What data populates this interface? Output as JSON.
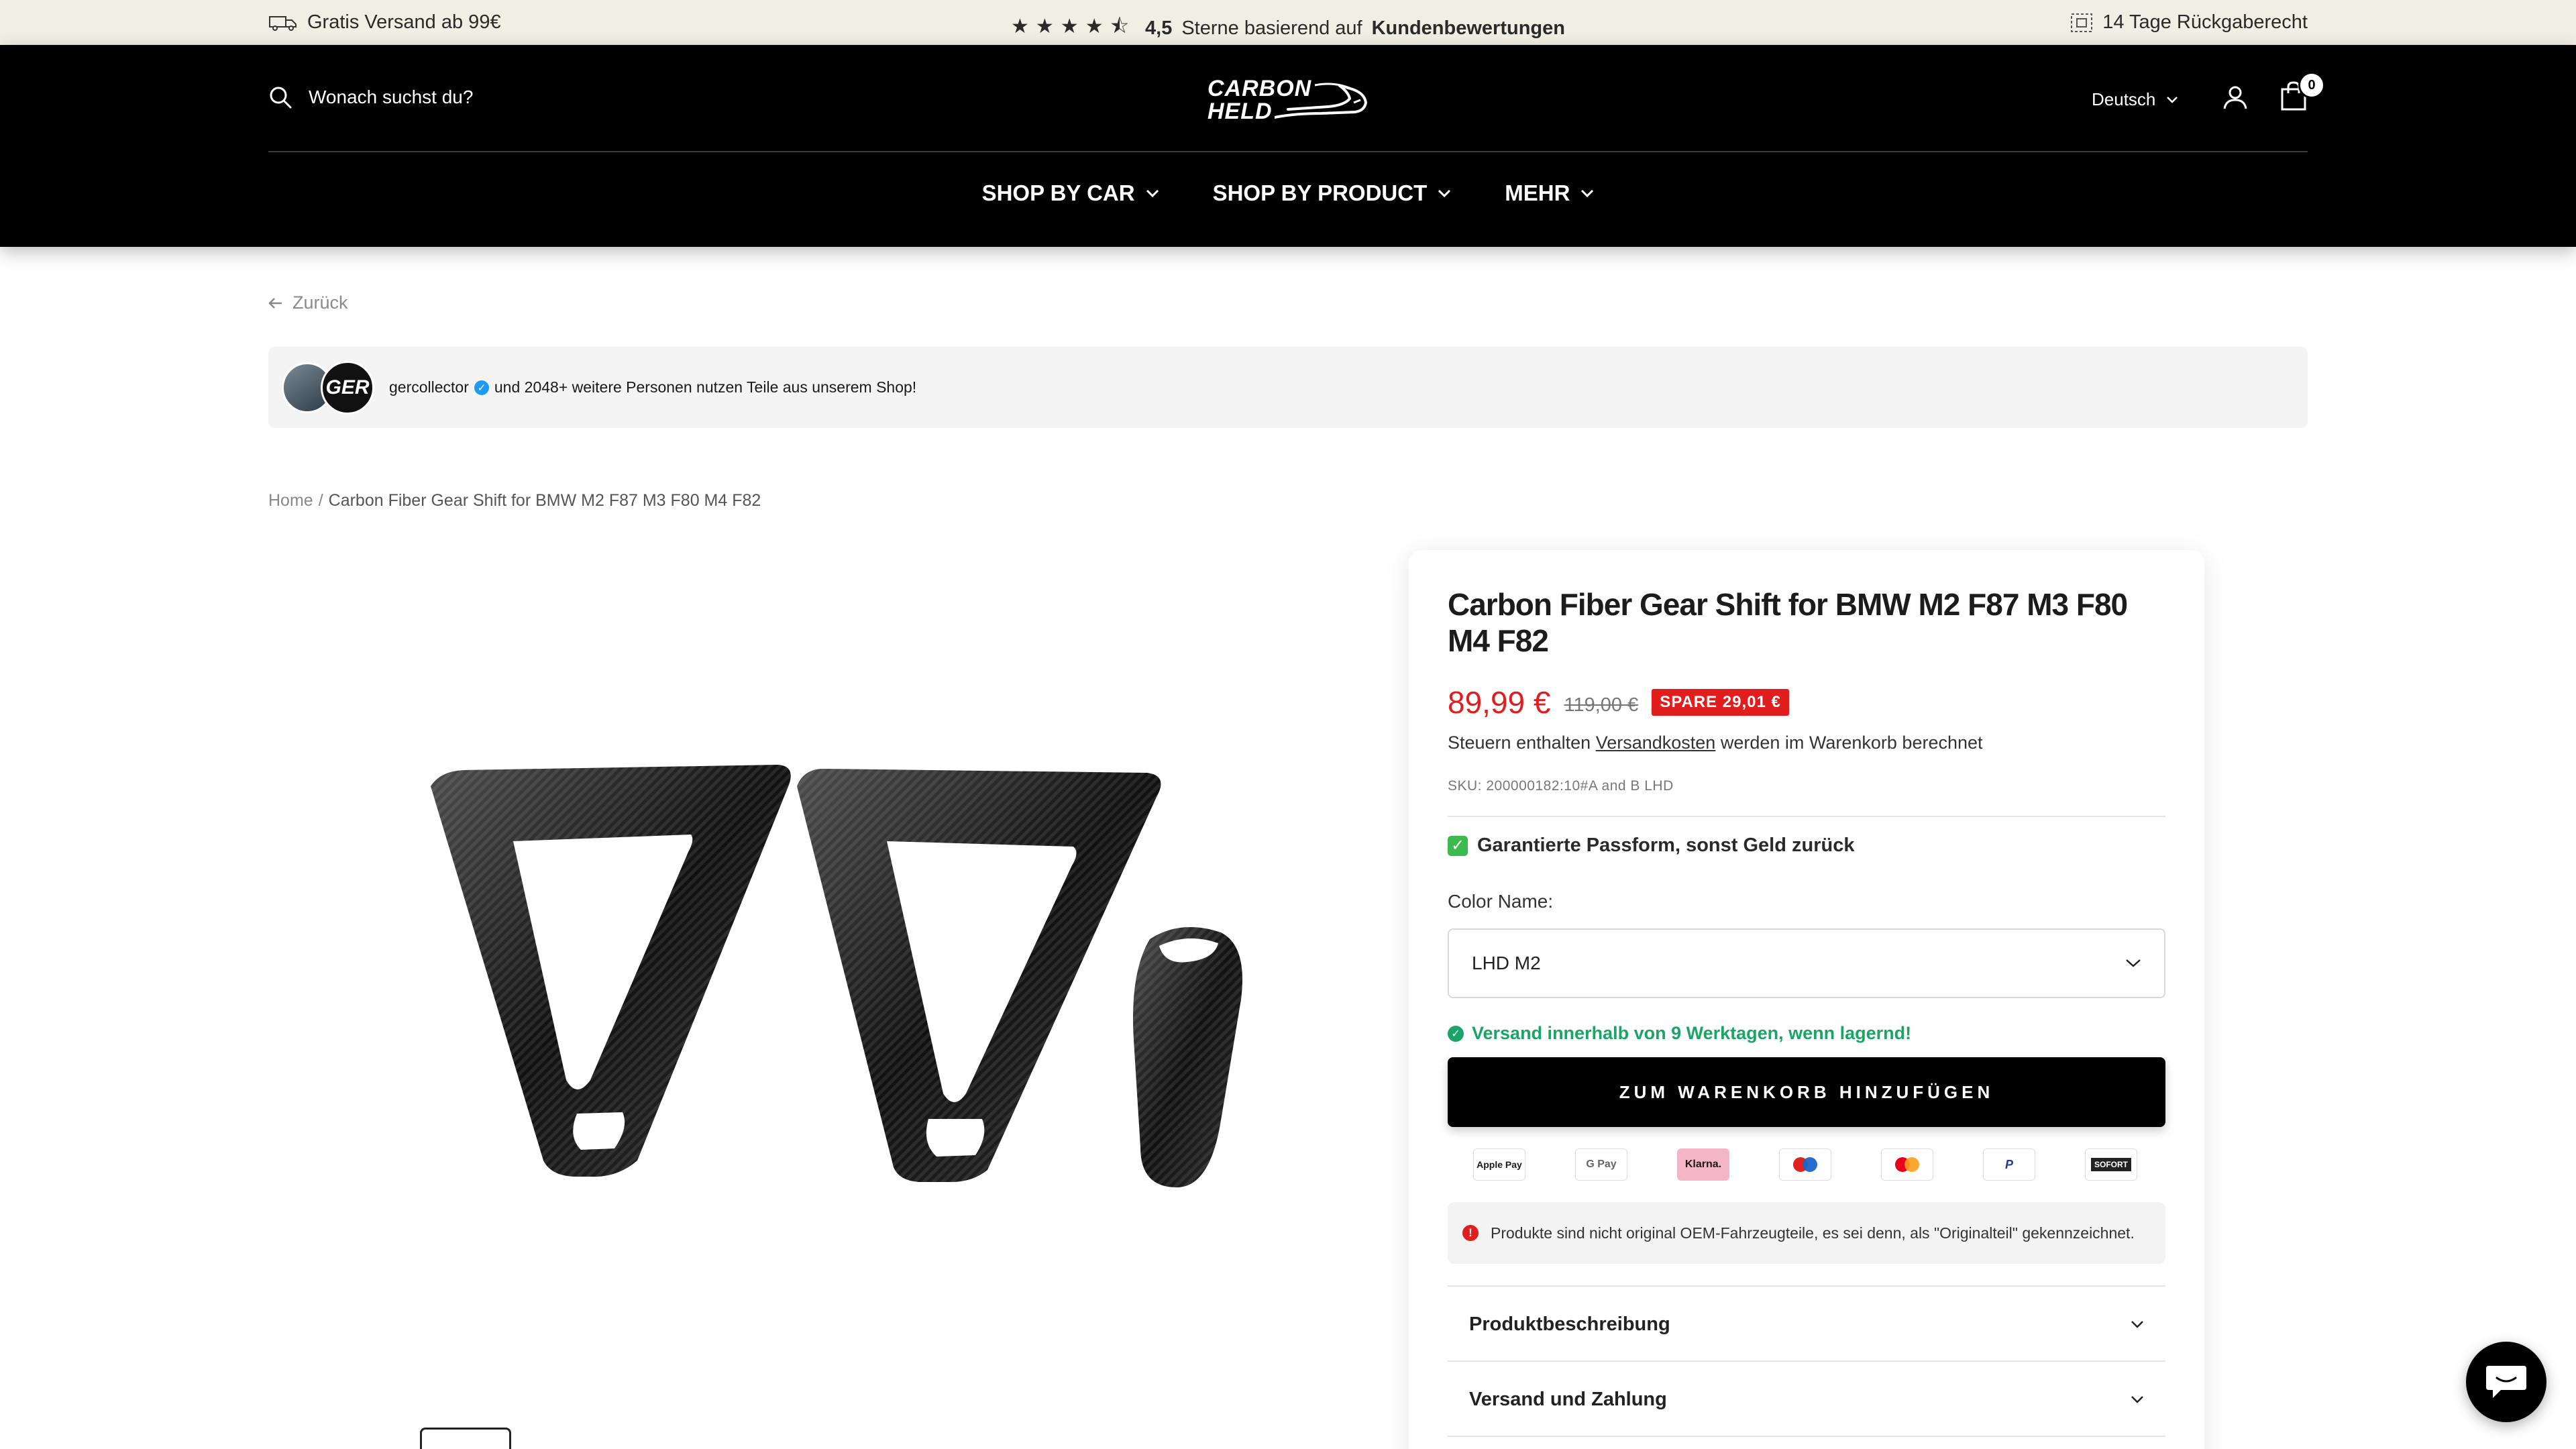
{
  "announcement": {
    "left_text": "Gratis Versand ab 99€",
    "stars": "★★★★⯪",
    "rating": "4,5",
    "rating_text": "Sterne basierend auf",
    "rating_link": "Kundenbewertungen",
    "right_text": "14 Tage Rückgaberecht"
  },
  "header": {
    "search_placeholder": "Wonach suchst du?",
    "logo_line1": "CARBON",
    "logo_line2": "HELD",
    "language": "Deutsch",
    "cart_count": "0"
  },
  "nav": {
    "items": [
      {
        "label": "SHOP BY CAR"
      },
      {
        "label": "SHOP BY PRODUCT"
      },
      {
        "label": "MEHR"
      }
    ]
  },
  "back_label": "Zurück",
  "social": {
    "avatar_text": "GER",
    "username": "gercollector",
    "text": "und 2048+ weitere Personen nutzen Teile aus unserem Shop!"
  },
  "breadcrumb": {
    "home": "Home",
    "separator": "/",
    "current": "Carbon Fiber Gear Shift for BMW M2 F87 M3 F80 M4 F82"
  },
  "product": {
    "title": "Carbon Fiber Gear Shift for BMW M2 F87 M3 F80 M4 F82",
    "price": "89,99 €",
    "compare_price": "119,00 €",
    "save_badge": "SPARE 29,01 €",
    "tax_prefix": "Steuern enthalten",
    "tax_link": "Versandkosten",
    "tax_suffix": "werden im Warenkorb berechnet",
    "sku": "SKU: 200000182:10#A and B LHD",
    "guarantee": "Garantierte Passform, sonst Geld zurück",
    "option_label": "Color Name:",
    "option_value": "LHD M2",
    "shipping": "Versand innerhalb von 9 Werktagen, wenn lagernd!",
    "add_to_cart": "ZUM WARENKORB HINZUFÜGEN",
    "payments": [
      "Apple Pay",
      "G Pay",
      "Klarna.",
      "Maestro",
      "Mastercard",
      "PayPal",
      "SOFORT"
    ],
    "notice": "Produkte sind nicht original OEM-Fahrzeugteile, es sei denn, als \"Originalteil\" gekennzeichnet.",
    "accordions": [
      {
        "label": "Produktbeschreibung"
      },
      {
        "label": "Versand und Zahlung"
      }
    ]
  },
  "colors": {
    "announcement_bg": "#f1eee3",
    "header_bg": "#000000",
    "price_red": "#e11d1d",
    "stock_green": "#1aa567"
  }
}
